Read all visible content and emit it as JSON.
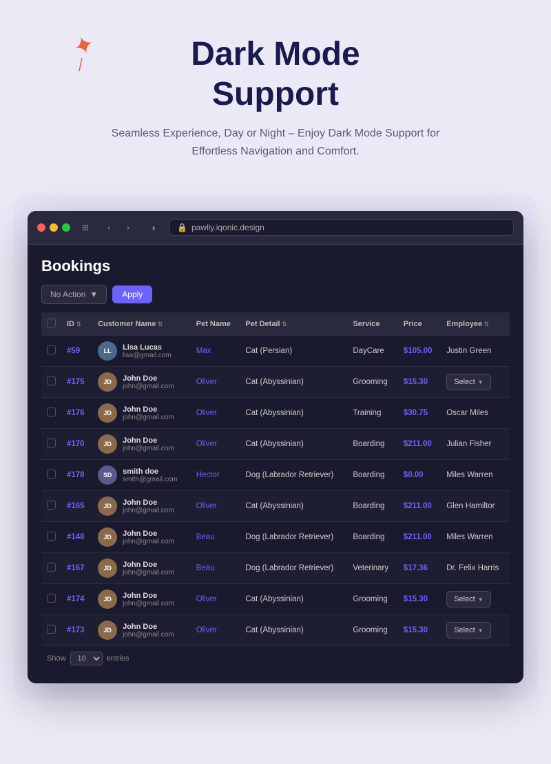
{
  "header": {
    "title_line1": "Dark Mode",
    "title_line2": "Support",
    "subtitle": "Seamless Experience, Day or Night – Enjoy Dark Mode Support for Effortless Navigation and Comfort."
  },
  "browser": {
    "url": "pawlly.iqonic.design",
    "traffic_lights": [
      "red",
      "yellow",
      "green"
    ]
  },
  "app": {
    "page_title": "Bookings",
    "action_bar": {
      "action_label": "No Action",
      "apply_label": "Apply"
    },
    "table": {
      "columns": [
        "",
        "ID",
        "Customer Name",
        "Pet Name",
        "Pet Detail",
        "Service",
        "Price",
        "Employee"
      ],
      "rows": [
        {
          "id": "#59",
          "customer_name": "Lisa Lucas",
          "customer_email": "lisa@gmail.com",
          "pet_name": "Max",
          "pet_detail": "Cat (Persian)",
          "service": "DayCare",
          "price": "$105.00",
          "employee": "Justin Green",
          "has_select": false
        },
        {
          "id": "#175",
          "customer_name": "John Doe",
          "customer_email": "john@gmail.com",
          "pet_name": "Oliver",
          "pet_detail": "Cat (Abyssinian)",
          "service": "Grooming",
          "price": "$15.30",
          "employee": "",
          "has_select": true
        },
        {
          "id": "#176",
          "customer_name": "John Doe",
          "customer_email": "john@gmail.com",
          "pet_name": "Oliver",
          "pet_detail": "Cat (Abyssinian)",
          "service": "Training",
          "price": "$30.75",
          "employee": "Oscar Miles",
          "has_select": false
        },
        {
          "id": "#170",
          "customer_name": "John Doe",
          "customer_email": "john@gmail.com",
          "pet_name": "Oliver",
          "pet_detail": "Cat (Abyssinian)",
          "service": "Boarding",
          "price": "$211.00",
          "employee": "Julian Fisher",
          "has_select": false
        },
        {
          "id": "#178",
          "customer_name": "smith doe",
          "customer_email": "smith@gmail.com",
          "pet_name": "Hector",
          "pet_detail": "Dog (Labrador Retriever)",
          "service": "Boarding",
          "price": "$0.00",
          "employee": "Miles Warren",
          "has_select": false
        },
        {
          "id": "#165",
          "customer_name": "John Doe",
          "customer_email": "john@gmail.com",
          "pet_name": "Oliver",
          "pet_detail": "Cat (Abyssinian)",
          "service": "Boarding",
          "price": "$211.00",
          "employee": "Glen Hamiltor",
          "has_select": false
        },
        {
          "id": "#148",
          "customer_name": "John Doe",
          "customer_email": "john@gmail.com",
          "pet_name": "Beau",
          "pet_detail": "Dog (Labrador Retriever)",
          "service": "Boarding",
          "price": "$211.00",
          "employee": "Miles Warren",
          "has_select": false
        },
        {
          "id": "#167",
          "customer_name": "John Doe",
          "customer_email": "john@gmail.com",
          "pet_name": "Beau",
          "pet_detail": "Dog (Labrador Retriever)",
          "service": "Veterinary",
          "price": "$17.36",
          "employee": "Dr. Felix Harris",
          "has_select": false
        },
        {
          "id": "#174",
          "customer_name": "John Doe",
          "customer_email": "john@gmail.com",
          "pet_name": "Oliver",
          "pet_detail": "Cat (Abyssinian)",
          "service": "Grooming",
          "price": "$15.30",
          "employee": "",
          "has_select": true
        },
        {
          "id": "#173",
          "customer_name": "John Doe",
          "customer_email": "john@gmail.com",
          "pet_name": "Oliver",
          "pet_detail": "Cat (Abyssinian)",
          "service": "Grooming",
          "price": "$15.30",
          "employee": "",
          "has_select": true
        }
      ]
    },
    "footer": {
      "show_label": "Show",
      "entries_label": "entries",
      "show_value": "10"
    }
  }
}
